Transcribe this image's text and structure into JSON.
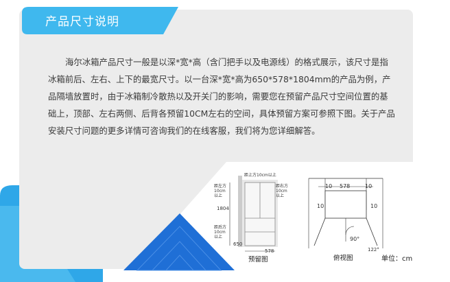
{
  "header": {
    "title": "产品尺寸说明"
  },
  "description": "海尔冰箱产品尺寸一般是以深*宽*高（含门把手以及电源线）的格式展示，该尺寸是指冰箱前后、左右、上下的最宽尺寸。以一台深*宽*高为650*578*1804mm的产品为例，产品隔墙放置时，由于冰箱制冷散热以及开关门的影响，需要您在预留产品尺寸空间位置的基础上，顶部、左右两侧、后背各预留10CM左右的空间，具体预留方案可参照下图。关于产品安装尺寸问题的更多详情可咨询我们的在线客服，我们将为您详细解答。",
  "front_view": {
    "caption": "预留图",
    "top_label": "距上方10cm以上",
    "left_label": "距左方10cm以上",
    "right_label": "距右方10cm以上",
    "back_label": "距后方10cm以上",
    "height": "1804",
    "width": "578",
    "depth": "650"
  },
  "top_view": {
    "caption": "俯视图",
    "top_dim_left": "10",
    "top_dim_width": "578",
    "top_dim_right": "10",
    "side_left": "10",
    "side_right": "10",
    "angle": "90°",
    "angle2": "122°"
  },
  "unit_label": "单位：cm",
  "colors": {
    "accent": "#3fb8ee",
    "deep_blue": "#1f6fd6",
    "panel": "#ececec"
  }
}
